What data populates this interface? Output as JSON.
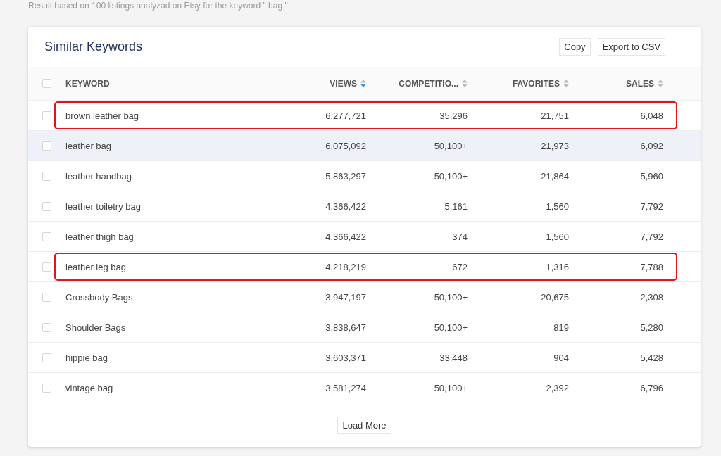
{
  "caption": "Result based on 100 listings analyzad on Etsy for the keyword \" bag \"",
  "card": {
    "title": "Similar Keywords",
    "actions": [
      "Copy",
      "Export to CSV"
    ]
  },
  "table": {
    "select_all": {
      "checked": false
    },
    "columns": [
      {
        "label": "KEYWORD"
      },
      {
        "label": "VIEWS",
        "sorted": true
      },
      {
        "label": "COMPETITIO...",
        "sorted": false
      },
      {
        "label": "FAVORITES",
        "sorted": false
      },
      {
        "label": "SALES",
        "sorted": false
      }
    ],
    "rows": [
      {
        "checked": false,
        "hovered": false,
        "highlighted": true,
        "cells": [
          "brown leather bag",
          "6,277,721",
          "35,296",
          "21,751",
          "6,048"
        ]
      },
      {
        "checked": false,
        "hovered": true,
        "highlighted": false,
        "cells": [
          "leather bag",
          "6,075,092",
          "50,100+",
          "21,973",
          "6,092"
        ]
      },
      {
        "checked": false,
        "hovered": false,
        "highlighted": false,
        "cells": [
          "leather handbag",
          "5,863,297",
          "50,100+",
          "21,864",
          "5,960"
        ]
      },
      {
        "checked": false,
        "hovered": false,
        "highlighted": false,
        "cells": [
          "leather toiletry bag",
          "4,366,422",
          "5,161",
          "1,560",
          "7,792"
        ]
      },
      {
        "checked": false,
        "hovered": false,
        "highlighted": false,
        "cells": [
          "leather thigh bag",
          "4,366,422",
          "374",
          "1,560",
          "7,792"
        ]
      },
      {
        "checked": false,
        "hovered": false,
        "highlighted": true,
        "cells": [
          "leather leg bag",
          "4,218,219",
          "672",
          "1,316",
          "7,788"
        ]
      },
      {
        "checked": false,
        "hovered": false,
        "highlighted": false,
        "cells": [
          "Crossbody Bags",
          "3,947,197",
          "50,100+",
          "20,675",
          "2,308"
        ]
      },
      {
        "checked": false,
        "hovered": false,
        "highlighted": false,
        "cells": [
          "Shoulder Bags",
          "3,838,647",
          "50,100+",
          "819",
          "5,280"
        ]
      },
      {
        "checked": false,
        "hovered": false,
        "highlighted": false,
        "cells": [
          "hippie bag",
          "3,603,371",
          "33,448",
          "904",
          "5,428"
        ]
      },
      {
        "checked": false,
        "hovered": false,
        "highlighted": false,
        "cells": [
          "vintage bag",
          "3,581,274",
          "50,100+",
          "2,392",
          "6,796"
        ]
      }
    ]
  },
  "load_more": "Load More"
}
